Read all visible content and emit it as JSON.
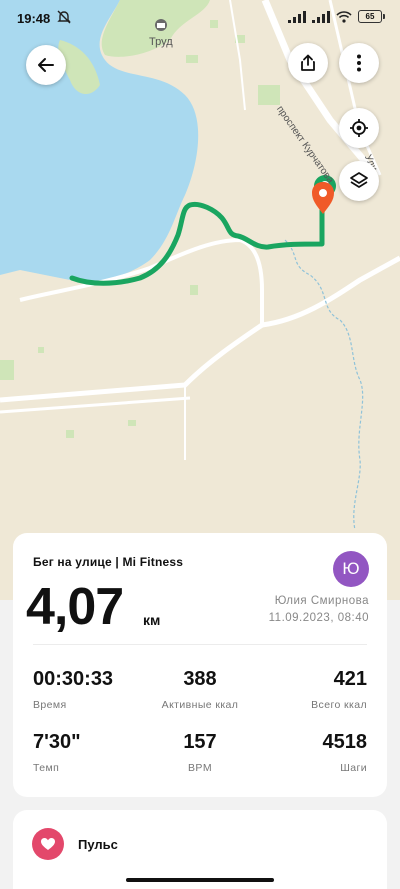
{
  "status_bar": {
    "time": "19:48",
    "battery": "65",
    "icons": [
      "mute-icon",
      "signal-icon",
      "signal-icon",
      "wifi-icon",
      "battery-icon"
    ]
  },
  "map": {
    "labels": {
      "village": "Труд",
      "avenue": "проспект Курчатова",
      "street_partial": "Ули"
    },
    "route_color": "#1aa560",
    "start_marker_color": "#1aa560",
    "end_marker_color": "#f05a28",
    "water_color": "#a9d9ef",
    "land_color": "#efe8d6",
    "buttons": [
      "back-icon",
      "share-icon",
      "more-icon",
      "locate-icon",
      "layers-icon"
    ]
  },
  "summary": {
    "activity_title": "Бег на улице | Mi Fitness",
    "distance": "4,07",
    "unit": "км",
    "avatar_letter": "Ю",
    "avatar_color": "#9256c2",
    "user_name": "Юлия Смирнова",
    "date": "11.09.2023, 08:40",
    "stats": [
      {
        "value": "00:30:33",
        "label": "Время"
      },
      {
        "value": "388",
        "label": "Активные ккал"
      },
      {
        "value": "421",
        "label": "Всего ккал"
      },
      {
        "value": "7'30\"",
        "label": "Темп"
      },
      {
        "value": "157",
        "label": "BPM"
      },
      {
        "value": "4518",
        "label": "Шаги"
      }
    ]
  },
  "pulse": {
    "label": "Пульс",
    "icon": "heart-icon",
    "icon_color": "#e3486b"
  }
}
